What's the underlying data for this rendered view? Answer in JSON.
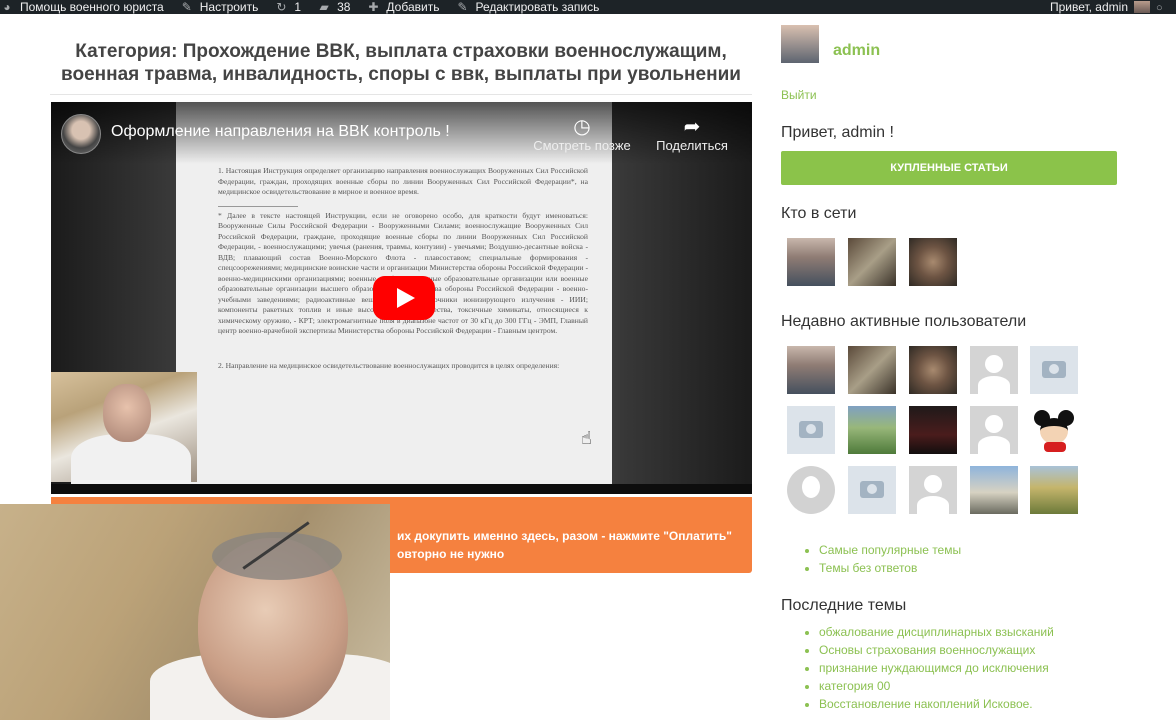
{
  "adminbar": {
    "site_name": "Помощь военного юриста",
    "customize": "Настроить",
    "updates_count": "1",
    "comments_count": "38",
    "add_new": "Добавить",
    "edit_post": "Редактировать запись",
    "greeting": "Привет, admin"
  },
  "main": {
    "category_title": "Категория: Прохождение ВВК, выплата страховки военнослужащим, военная травма, инвалидность, споры с ввк, выплаты при увольнении"
  },
  "video": {
    "title": "Оформление направления на ВВК контроль !",
    "watch_later": "Смотреть позже",
    "share": "Поделиться",
    "doc_p1": "1. Настоящая Инструкция определяет организацию направления военнослужащих Вооруженных Сил Российской Федерации, граждан, проходящих военные сборы по линии Вооруженных Сил Российской Федерации*, на медицинское освидетельствование в мирное и военное время.",
    "doc_p2": "* Далее в тексте настоящей Инструкции, если не оговорено особо, для краткости будут именоваться: Вооруженные Силы Российской Федерации - Вооруженными Силами; военнослужащие Вооруженных Сил Российской Федерации, граждане, проходящие военные сборы по линии Вооруженных Сил Российской Федерации, - военнослужащими; увечья (ранения, травмы, контузии) - увечьями; Воздушно-десантные войска - ВДВ; плавающий состав Военно-Морского Флота - плавсоставом; специальные формирования - спецсоорежениями; медицинские воинские части и организации Министерства обороны Российской Федерации - военно-медицинскими организациями; военные профессиональные образовательные организации или военные образовательные организации высшего образования Министерства обороны Российской Федерации - военно-учебными заведениями; радиоактивные вещества - РВ; источники ионизирующего излучения - ИИИ; компоненты ракетных топлив и иные высокотоксичные вещества, токсичные химикаты, относящиеся к химическому оружию, - КРТ; электромагнитные поля в диапазоне частот от 30 кГц до 300 ГГц - ЭМП, Главный центр военно-врачебной экспертизы Министерства обороны Российской Федерации - Главным центром.",
    "doc_p3": "2. Направление на медицинское освидетельствование военнослужащих проводится в целях определения:"
  },
  "banner": {
    "line1": "их докупить именно здесь, разом - нажмите \"Оплатить\"",
    "line2_prefix": "овторно ",
    "line2_bold": "не нужно"
  },
  "sidebar": {
    "username": "admin",
    "logout": "Выйти",
    "hello": "Привет, admin !",
    "purchased_button": "КУПЛЕННЫЕ СТАТЬИ",
    "online_title": "Кто в сети",
    "recent_users_title": "Недавно активные пользователи",
    "links": [
      "Самые популярные темы",
      "Темы без ответов"
    ],
    "latest_title": "Последние темы",
    "latest_topics": [
      "обжалование дисциплинарных взысканий",
      "Основы страхования военнослужащих",
      "признание нуждающимся до исключения",
      "категория 00",
      "Восстановление накоплений Исковое."
    ]
  },
  "colors": {
    "accent_green": "#8cc152",
    "button_green": "#8bc34a",
    "banner_orange": "#f5813f",
    "adminbar_bg": "#1d2327",
    "play_red": "#ff0000"
  },
  "icons": {
    "site": "dashboard-icon",
    "customize": "brush-icon",
    "updates": "refresh-icon",
    "comments": "comment-icon",
    "add": "plus-icon",
    "edit": "pencil-icon",
    "watch_later": "clock-icon",
    "share": "share-arrow-icon",
    "play": "youtube-play-icon"
  }
}
